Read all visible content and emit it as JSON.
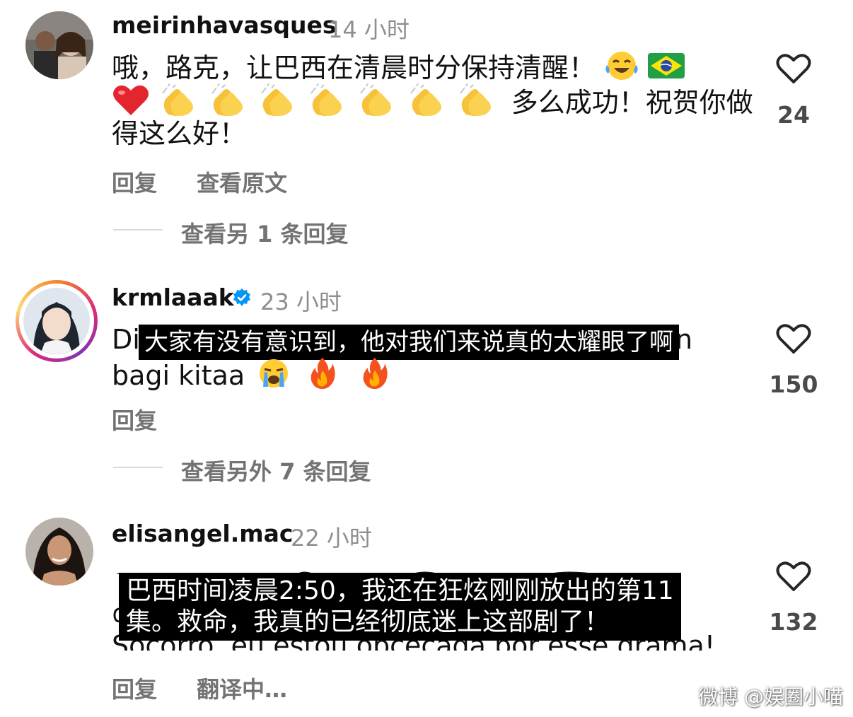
{
  "comments": [
    {
      "username": "meirinhavasques",
      "time": "14 小时",
      "line1": "哦，路克，让巴西在清晨时分保持清醒！",
      "line2_suffix": "多么成功！祝贺你做",
      "line3": "得这么好！",
      "reply": "回复",
      "see_translation": "查看原文",
      "view_replies": "查看另 1 条回复",
      "likes": "24"
    },
    {
      "username": "krmlaaak",
      "time": "23 小时",
      "line1_start": "Di",
      "line1_end": "n",
      "line2": "bagi kitaa",
      "overlay_subtitle": "大家有没有意识到，他对我们来说真的太耀眼了啊",
      "reply": "回复",
      "view_replies": "查看另外 7 条回复",
      "likes": "150"
    },
    {
      "username": "elisangel.mac",
      "time": "22 小时",
      "line3": "Socorro, eu estou obcecada por esse drama!",
      "overlay_subtitle_line1": "巴西时间凌晨2:50，我还在狂炫刚刚放出的第11",
      "overlay_subtitle_line2": "集。救命，我真的已经彻底迷上这部剧了！",
      "reply": "回复",
      "translating": "翻译中…",
      "likes": "132"
    }
  ],
  "watermark": "微博 @娱圈小喵",
  "colors": {
    "text": "#111111",
    "muted": "#737373",
    "time": "#8e8e8e",
    "verified": "#0095f6",
    "divider": "#dbdbdb"
  },
  "icons": {
    "like": "heart-outline-icon",
    "verified": "verified-badge-icon",
    "emoji_laugh": "tears-of-joy-emoji",
    "emoji_flag": "brazil-flag-emoji",
    "emoji_heart": "red-heart-emoji",
    "emoji_clap": "clapping-hands-emoji",
    "emoji_cry": "loudly-crying-emoji",
    "emoji_fire": "fire-emoji"
  }
}
